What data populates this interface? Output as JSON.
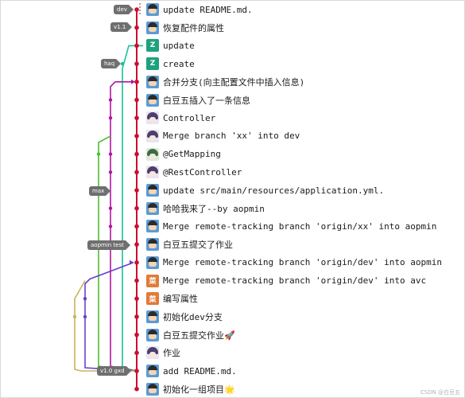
{
  "colors": {
    "red": "#c8102e",
    "magenta": "#b0179f",
    "green": "#4cbf2e",
    "teal": "#19c2a0",
    "purple": "#6a3fd0",
    "olive": "#c8b45a",
    "tag_bg": "#6f6f6f"
  },
  "tags": {
    "dev": "dev",
    "v11": "v1.1",
    "haq": "haq",
    "max": "max",
    "aopmin_test": "aopmin test",
    "v10_gxd": "v1.0 gxd"
  },
  "commits": [
    {
      "message": "update README.md.",
      "avatar": "blue",
      "initial": ""
    },
    {
      "message": "恢复配件的属性",
      "avatar": "blue",
      "initial": ""
    },
    {
      "message": " update",
      "avatar": "teal",
      "initial": "Z"
    },
    {
      "message": " create",
      "avatar": "teal",
      "initial": "Z"
    },
    {
      "message": "合并分支(向主配置文件中插入信息)",
      "avatar": "blue",
      "initial": ""
    },
    {
      "message": "白豆五插入了一条信息",
      "avatar": "blue",
      "initial": ""
    },
    {
      "message": "Controller",
      "avatar": "anime",
      "initial": ""
    },
    {
      "message": "Merge branch 'xx' into dev",
      "avatar": "anime",
      "initial": ""
    },
    {
      "message": "@GetMapping",
      "avatar": "green",
      "initial": ""
    },
    {
      "message": "@RestController",
      "avatar": "anime",
      "initial": ""
    },
    {
      "message": "update src/main/resources/application.yml.",
      "avatar": "blue",
      "initial": ""
    },
    {
      "message": "哈哈我来了--by aopmin",
      "avatar": "blue",
      "initial": ""
    },
    {
      "message": "Merge remote-tracking branch 'origin/xx' into aopmin",
      "avatar": "blue",
      "initial": ""
    },
    {
      "message": "白豆五提交了作业",
      "avatar": "blue",
      "initial": ""
    },
    {
      "message": "Merge remote-tracking branch 'origin/dev' into aopmin",
      "avatar": "blue",
      "initial": ""
    },
    {
      "message": "Merge remote-tracking branch 'origin/dev' into avc",
      "avatar": "orange",
      "initial": "菜"
    },
    {
      "message": "编写属性",
      "avatar": "orange",
      "initial": "菜"
    },
    {
      "message": "初始化dev分支",
      "avatar": "blue",
      "initial": ""
    },
    {
      "message": "白豆五提交作业🚀",
      "avatar": "blue",
      "initial": ""
    },
    {
      "message": " 作业",
      "avatar": "anime",
      "initial": ""
    },
    {
      "message": "add README.md.",
      "avatar": "blue",
      "initial": ""
    },
    {
      "message": "初始化一组项目🌟",
      "avatar": "blue",
      "initial": ""
    }
  ],
  "watermark": "CSDN @白豆五"
}
